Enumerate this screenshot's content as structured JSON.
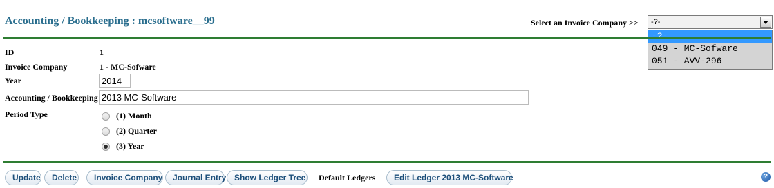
{
  "header": {
    "title": "Accounting / Bookkeeping : mcsoftware__99",
    "select_label": "Select an Invoice Company >>"
  },
  "company_select": {
    "selected": "-?-",
    "options": [
      "-?-",
      "049 - MC-Sofware",
      "051 - AVV-296"
    ],
    "highlighted_index": 0
  },
  "form": {
    "id_label": "ID",
    "id_value": "1",
    "invoice_company_label": "Invoice Company",
    "invoice_company_value": "1 - MC-Sofware",
    "year_label": "Year",
    "year_value": "2014",
    "bookkeeping_label": "Accounting / Bookkeeping",
    "bookkeeping_value": "2013 MC-Software",
    "period_type_label": "Period Type",
    "period_options": [
      "(1) Month",
      "(2) Quarter",
      "(3) Year"
    ],
    "period_selected_index": 2
  },
  "toolbar": {
    "update": "Update",
    "delete": "Delete",
    "invoice_company": "Invoice Company",
    "journal_entry": "Journal Entry",
    "show_ledger_tree": "Show Ledger Tree",
    "default_ledgers": "Default Ledgers",
    "edit_ledger": "Edit Ledger 2013 MC-Software"
  },
  "icons": {
    "help": "question-mark-icon",
    "dropdown": "chevron-down-icon"
  },
  "colors": {
    "title": "#2a6e8e",
    "divider": "#2e7d32",
    "highlight": "#3399ff",
    "button_text": "#1d4f7a"
  }
}
